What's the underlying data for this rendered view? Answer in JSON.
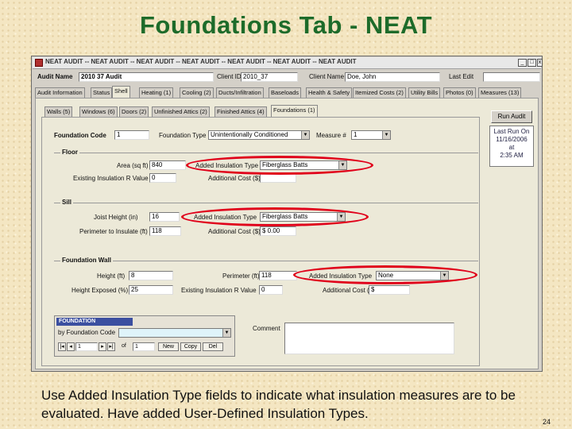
{
  "slide": {
    "title": "Foundations Tab - NEAT",
    "caption": "Use Added Insulation Type fields to indicate what insulation measures are to be evaluated. Have added User-Defined Insulation Types.",
    "page_number": "24"
  },
  "window": {
    "title": "NEAT AUDIT  --  NEAT AUDIT  --  NEAT AUDIT  --  NEAT AUDIT  --  NEAT AUDIT  --  NEAT AUDIT  --  NEAT AUDIT",
    "minimize": "_",
    "maximize": "□",
    "close": "x"
  },
  "header": {
    "audit_name_label": "Audit Name",
    "audit_name_value": "2010  37 Audit",
    "client_id_label": "Client ID",
    "client_id_value": "2010_37",
    "client_name_label": "Client Name",
    "client_name_value": "Doe, John",
    "last_edit_label": "Last Edit"
  },
  "main_tabs": [
    "Audit Information",
    "Status",
    "Shell",
    "Heating (1)",
    "Cooling (2)",
    "Ducts/Infiltration",
    "Baseloads",
    "Health & Safety",
    "Itemized Costs (2)",
    "Utility Bills",
    "Photos (0)",
    "Measures (13)"
  ],
  "sub_tabs": [
    "Walls (5)",
    "Windows (6)",
    "Doors (2)",
    "Unfinished Attics (2)",
    "Finished Attics (4)",
    "Foundations (1)"
  ],
  "run_audit": {
    "label": "Run Audit",
    "last_run_label": "Last Run On",
    "last_run_date": "11/16/2006",
    "at": "at",
    "time": "2:35 AM"
  },
  "top_row": {
    "code_label": "Foundation Code",
    "code_value": "1",
    "type_label": "Foundation Type",
    "type_value": "Unintentionally Conditioned",
    "measure_label": "Measure #",
    "measure_value": "1"
  },
  "floor": {
    "title": "Floor",
    "area_label": "Area (sq ft)",
    "area_value": "840",
    "rvalue_label": "Existing Insulation R Value",
    "rvalue_value": "0",
    "added_type_label": "Added Insulation Type",
    "added_type_value": "Fiberglass Batts",
    "cost_label": "Additional Cost ($)",
    "cost_value": ""
  },
  "sill": {
    "title": "Sill",
    "joist_label": "Joist Height (in)",
    "joist_value": "16",
    "perimeter_label": "Perimeter to Insulate (ft)",
    "perimeter_value": "118",
    "added_type_label": "Added Insulation Type",
    "added_type_value": "Fiberglass Batts",
    "cost_label": "Additional Cost ($)",
    "cost_value": "$ 0.00"
  },
  "wall": {
    "title": "Foundation Wall",
    "height_label": "Height (ft)",
    "height_value": "8",
    "exposed_label": "Height Exposed (%)",
    "exposed_value": "25",
    "perimeter_label": "Perimeter (ft)",
    "perimeter_value": "118",
    "rvalue_label": "Existing Insulation R Value",
    "rvalue_value": "0",
    "added_type_label": "Added Insulation Type",
    "added_type_value": "None",
    "cost_label": "Additional Cost ($)",
    "cost_value": "$"
  },
  "nav": {
    "header": "FOUNDATION",
    "by_label": "by Foundation Code",
    "record": "1",
    "of_label": "of",
    "total": "1",
    "new": "New",
    "copy": "Copy",
    "delete": "Del"
  },
  "comment_label": "Comment",
  "colors": {
    "title_green": "#1d6b2a",
    "highlight_ring": "#e0001a"
  }
}
